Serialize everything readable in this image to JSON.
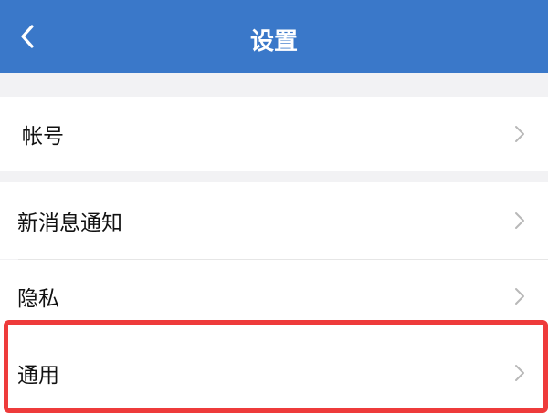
{
  "navbar": {
    "title": "设置",
    "back_icon": "chevron-left-icon",
    "color": "#3a78c9"
  },
  "sections": [
    {
      "items": [
        {
          "label": "帐号",
          "icon": "chevron-right-icon"
        }
      ]
    },
    {
      "items": [
        {
          "label": "新消息通知",
          "icon": "chevron-right-icon"
        },
        {
          "label": "隐私",
          "icon": "chevron-right-icon"
        },
        {
          "label": "通用",
          "icon": "chevron-right-icon",
          "highlighted": true
        }
      ]
    }
  ],
  "highlight_color": "#ee3b3b"
}
